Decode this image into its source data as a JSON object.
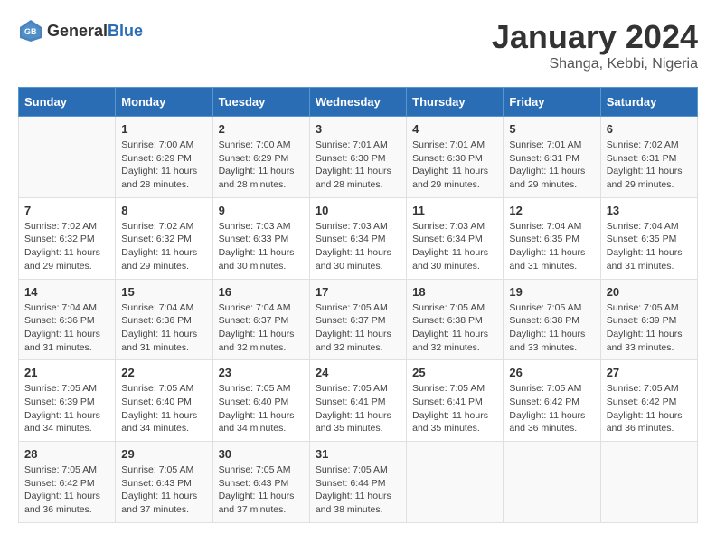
{
  "header": {
    "logo_general": "General",
    "logo_blue": "Blue",
    "month_year": "January 2024",
    "location": "Shanga, Kebbi, Nigeria"
  },
  "calendar": {
    "weekdays": [
      "Sunday",
      "Monday",
      "Tuesday",
      "Wednesday",
      "Thursday",
      "Friday",
      "Saturday"
    ],
    "weeks": [
      [
        {
          "day": "",
          "sunrise": "",
          "sunset": "",
          "daylight": ""
        },
        {
          "day": "1",
          "sunrise": "Sunrise: 7:00 AM",
          "sunset": "Sunset: 6:29 PM",
          "daylight": "Daylight: 11 hours and 28 minutes."
        },
        {
          "day": "2",
          "sunrise": "Sunrise: 7:00 AM",
          "sunset": "Sunset: 6:29 PM",
          "daylight": "Daylight: 11 hours and 28 minutes."
        },
        {
          "day": "3",
          "sunrise": "Sunrise: 7:01 AM",
          "sunset": "Sunset: 6:30 PM",
          "daylight": "Daylight: 11 hours and 28 minutes."
        },
        {
          "day": "4",
          "sunrise": "Sunrise: 7:01 AM",
          "sunset": "Sunset: 6:30 PM",
          "daylight": "Daylight: 11 hours and 29 minutes."
        },
        {
          "day": "5",
          "sunrise": "Sunrise: 7:01 AM",
          "sunset": "Sunset: 6:31 PM",
          "daylight": "Daylight: 11 hours and 29 minutes."
        },
        {
          "day": "6",
          "sunrise": "Sunrise: 7:02 AM",
          "sunset": "Sunset: 6:31 PM",
          "daylight": "Daylight: 11 hours and 29 minutes."
        }
      ],
      [
        {
          "day": "7",
          "sunrise": "Sunrise: 7:02 AM",
          "sunset": "Sunset: 6:32 PM",
          "daylight": "Daylight: 11 hours and 29 minutes."
        },
        {
          "day": "8",
          "sunrise": "Sunrise: 7:02 AM",
          "sunset": "Sunset: 6:32 PM",
          "daylight": "Daylight: 11 hours and 29 minutes."
        },
        {
          "day": "9",
          "sunrise": "Sunrise: 7:03 AM",
          "sunset": "Sunset: 6:33 PM",
          "daylight": "Daylight: 11 hours and 30 minutes."
        },
        {
          "day": "10",
          "sunrise": "Sunrise: 7:03 AM",
          "sunset": "Sunset: 6:34 PM",
          "daylight": "Daylight: 11 hours and 30 minutes."
        },
        {
          "day": "11",
          "sunrise": "Sunrise: 7:03 AM",
          "sunset": "Sunset: 6:34 PM",
          "daylight": "Daylight: 11 hours and 30 minutes."
        },
        {
          "day": "12",
          "sunrise": "Sunrise: 7:04 AM",
          "sunset": "Sunset: 6:35 PM",
          "daylight": "Daylight: 11 hours and 31 minutes."
        },
        {
          "day": "13",
          "sunrise": "Sunrise: 7:04 AM",
          "sunset": "Sunset: 6:35 PM",
          "daylight": "Daylight: 11 hours and 31 minutes."
        }
      ],
      [
        {
          "day": "14",
          "sunrise": "Sunrise: 7:04 AM",
          "sunset": "Sunset: 6:36 PM",
          "daylight": "Daylight: 11 hours and 31 minutes."
        },
        {
          "day": "15",
          "sunrise": "Sunrise: 7:04 AM",
          "sunset": "Sunset: 6:36 PM",
          "daylight": "Daylight: 11 hours and 31 minutes."
        },
        {
          "day": "16",
          "sunrise": "Sunrise: 7:04 AM",
          "sunset": "Sunset: 6:37 PM",
          "daylight": "Daylight: 11 hours and 32 minutes."
        },
        {
          "day": "17",
          "sunrise": "Sunrise: 7:05 AM",
          "sunset": "Sunset: 6:37 PM",
          "daylight": "Daylight: 11 hours and 32 minutes."
        },
        {
          "day": "18",
          "sunrise": "Sunrise: 7:05 AM",
          "sunset": "Sunset: 6:38 PM",
          "daylight": "Daylight: 11 hours and 32 minutes."
        },
        {
          "day": "19",
          "sunrise": "Sunrise: 7:05 AM",
          "sunset": "Sunset: 6:38 PM",
          "daylight": "Daylight: 11 hours and 33 minutes."
        },
        {
          "day": "20",
          "sunrise": "Sunrise: 7:05 AM",
          "sunset": "Sunset: 6:39 PM",
          "daylight": "Daylight: 11 hours and 33 minutes."
        }
      ],
      [
        {
          "day": "21",
          "sunrise": "Sunrise: 7:05 AM",
          "sunset": "Sunset: 6:39 PM",
          "daylight": "Daylight: 11 hours and 34 minutes."
        },
        {
          "day": "22",
          "sunrise": "Sunrise: 7:05 AM",
          "sunset": "Sunset: 6:40 PM",
          "daylight": "Daylight: 11 hours and 34 minutes."
        },
        {
          "day": "23",
          "sunrise": "Sunrise: 7:05 AM",
          "sunset": "Sunset: 6:40 PM",
          "daylight": "Daylight: 11 hours and 34 minutes."
        },
        {
          "day": "24",
          "sunrise": "Sunrise: 7:05 AM",
          "sunset": "Sunset: 6:41 PM",
          "daylight": "Daylight: 11 hours and 35 minutes."
        },
        {
          "day": "25",
          "sunrise": "Sunrise: 7:05 AM",
          "sunset": "Sunset: 6:41 PM",
          "daylight": "Daylight: 11 hours and 35 minutes."
        },
        {
          "day": "26",
          "sunrise": "Sunrise: 7:05 AM",
          "sunset": "Sunset: 6:42 PM",
          "daylight": "Daylight: 11 hours and 36 minutes."
        },
        {
          "day": "27",
          "sunrise": "Sunrise: 7:05 AM",
          "sunset": "Sunset: 6:42 PM",
          "daylight": "Daylight: 11 hours and 36 minutes."
        }
      ],
      [
        {
          "day": "28",
          "sunrise": "Sunrise: 7:05 AM",
          "sunset": "Sunset: 6:42 PM",
          "daylight": "Daylight: 11 hours and 36 minutes."
        },
        {
          "day": "29",
          "sunrise": "Sunrise: 7:05 AM",
          "sunset": "Sunset: 6:43 PM",
          "daylight": "Daylight: 11 hours and 37 minutes."
        },
        {
          "day": "30",
          "sunrise": "Sunrise: 7:05 AM",
          "sunset": "Sunset: 6:43 PM",
          "daylight": "Daylight: 11 hours and 37 minutes."
        },
        {
          "day": "31",
          "sunrise": "Sunrise: 7:05 AM",
          "sunset": "Sunset: 6:44 PM",
          "daylight": "Daylight: 11 hours and 38 minutes."
        },
        {
          "day": "",
          "sunrise": "",
          "sunset": "",
          "daylight": ""
        },
        {
          "day": "",
          "sunrise": "",
          "sunset": "",
          "daylight": ""
        },
        {
          "day": "",
          "sunrise": "",
          "sunset": "",
          "daylight": ""
        }
      ]
    ]
  }
}
